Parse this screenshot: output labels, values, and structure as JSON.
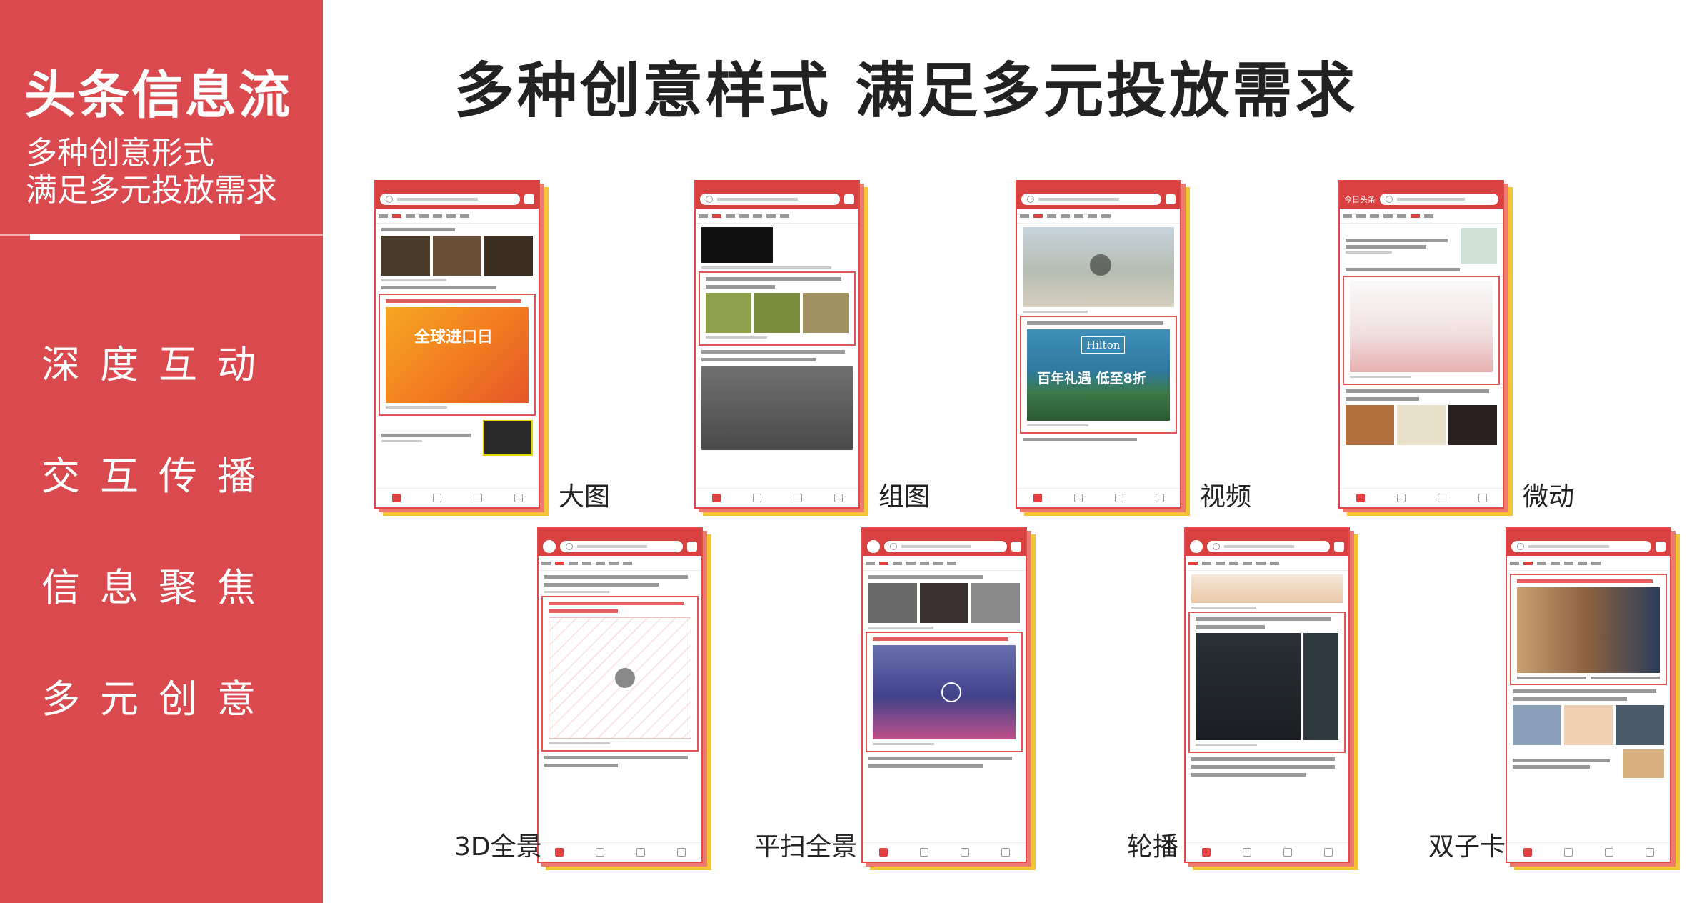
{
  "sidebar": {
    "title": "头条信息流",
    "subtitle_line1": "多种创意形式",
    "subtitle_line2": "满足多元投放需求",
    "items": [
      "深度互动",
      "交互传播",
      "信息聚焦",
      "多元创意"
    ]
  },
  "heading": "多种创意样式 满足多元投放需求",
  "formats": [
    {
      "label": "大图"
    },
    {
      "label": "组图"
    },
    {
      "label": "视频"
    },
    {
      "label": "微动"
    },
    {
      "label": "3D全景"
    },
    {
      "label": "平扫全景"
    },
    {
      "label": "轮播"
    },
    {
      "label": "双子卡"
    }
  ],
  "mock_text": {
    "hilton_brand": "Hilton",
    "hilton_promo": "百年礼遇 低至8折",
    "global_import_banner": "全球进口日",
    "top_app_name": "今日头条"
  },
  "colors": {
    "panel_red": "#d9494e",
    "accent_red": "#e04040",
    "frame_yellow": "#f4c232",
    "frame_coral": "#ee7a6f"
  }
}
